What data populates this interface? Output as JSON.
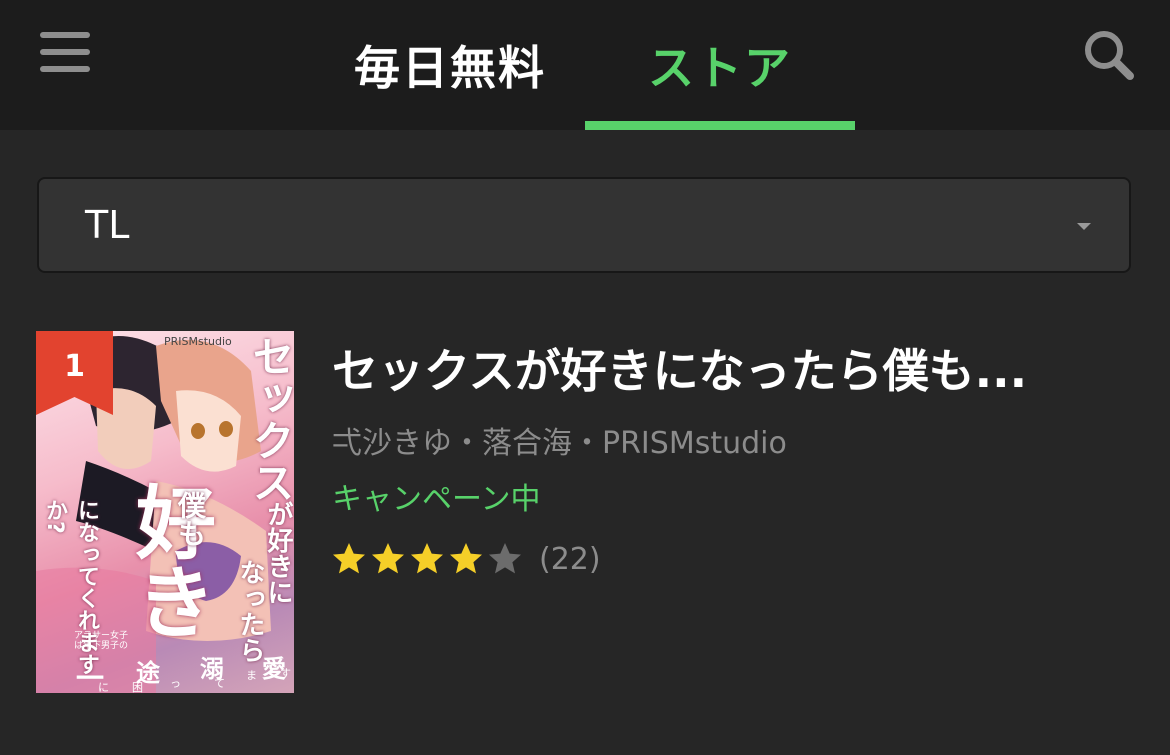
{
  "header": {
    "tabs": [
      {
        "label": "毎日無料",
        "active": false
      },
      {
        "label": "ストア",
        "active": true
      }
    ],
    "menu_icon": "hamburger-menu-icon",
    "search_icon": "search-icon",
    "accent_color": "#58d26a"
  },
  "genre_select": {
    "value": "TL",
    "icon": "caret-down-icon"
  },
  "ranking": {
    "items": [
      {
        "rank": "1",
        "title": "セックスが好きになったら僕も...",
        "authors": "弌沙きゆ・落合海・PRISMstudio",
        "status": "キャンペーン中",
        "rating": 4,
        "rating_max": 5,
        "review_count": "(22)",
        "cover_text": {
          "publisher": "PRISMstudio",
          "main_vertical": "セックス",
          "big_chars": "好き",
          "lines": [
            "が好きに",
            "なったら",
            "僕も",
            "になってくれますか?"
          ],
          "tagline": "アラサー女子は年下男子の",
          "bottom_chars": [
            "一",
            "途",
            "溺",
            "愛"
          ],
          "bottom_small": [
            "に",
            "困",
            "っ",
            "て",
            "ま",
            "す"
          ]
        }
      }
    ]
  }
}
